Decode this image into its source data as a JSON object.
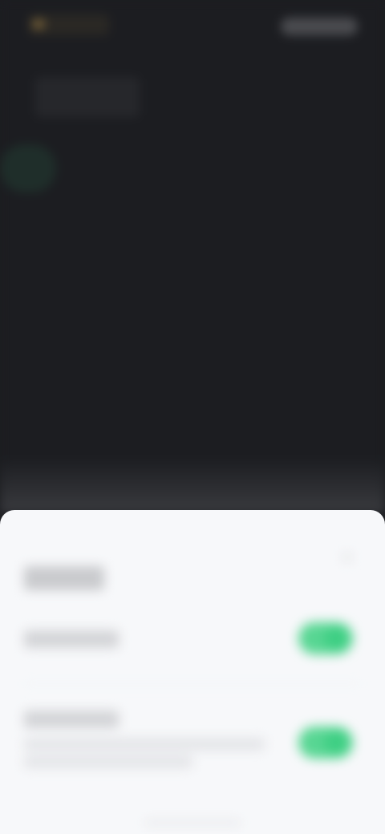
{
  "background_app": {
    "logo_icon": "app-logo-icon",
    "header_button_label": "",
    "title": ""
  },
  "sheet": {
    "title": "",
    "close_icon": "close-icon",
    "settings": [
      {
        "label": "",
        "subtitle": "",
        "enabled": true
      },
      {
        "label": "",
        "subtitle": "",
        "enabled": true
      }
    ]
  },
  "colors": {
    "background": "#1c1d21",
    "sheet": "#f7f8fa",
    "toggle_on": "#3fcf84"
  }
}
